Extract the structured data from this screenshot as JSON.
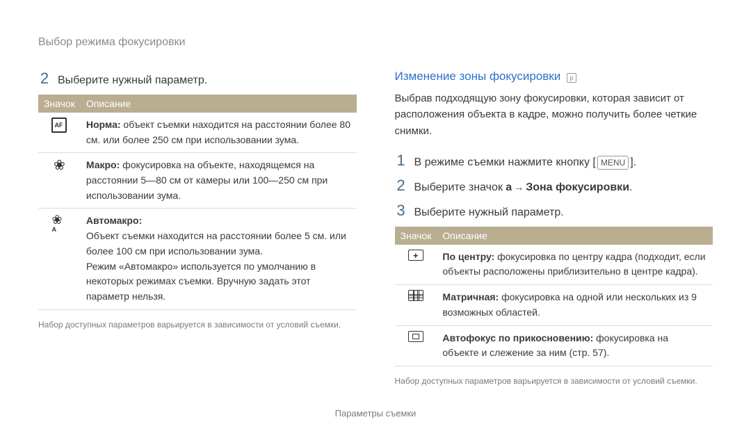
{
  "page_title": "Выбор режима фокусировки",
  "footer": "Параметры съемки",
  "left": {
    "step2_num": "2",
    "step2_text": "Выберите нужный параметр.",
    "table": {
      "head_icon": "Значок",
      "head_desc": "Описание",
      "row1_label": "Норма:",
      "row1_text": " объект съемки находится на расстоянии более 80 см. или более 250 см при использовании зума.",
      "row2_label": "Макро:",
      "row2_text": " фокусировка на объекте, находящемся на расстоянии 5—80 см от камеры или 100—250 см при использовании зума.",
      "row3_label": "Автомакро:",
      "row3_text_a": "Объект съемки находится на расстоянии более 5 см. или более 100 см при использовании зума.",
      "row3_text_b": "Режим «Автомакро» используется по умолчанию в некоторых режимах съемки. Вручную задать этот параметр нельзя."
    },
    "note": "Набор доступных параметров варьируется в зависимости от условий съемки."
  },
  "right": {
    "section_title": "Изменение зоны фокусировки",
    "intro": "Выбрав подходящую зону фокусировки, которая зависит от расположения объекта в кадре, можно получить более четкие снимки.",
    "step1_num": "1",
    "step1_text_a": "В режиме съемки нажмите кнопку [",
    "step1_text_b": "].",
    "step1_kbd": "MENU",
    "step2_num": "2",
    "step2_text_a": "Выберите значок ",
    "step2_bold": "a",
    "step2_arrow": "→",
    "step2_text_b": "Зона фокусировки",
    "step2_text_c": ".",
    "step3_num": "3",
    "step3_text": "Выберите нужный параметр.",
    "table": {
      "head_icon": "Значок",
      "head_desc": "Описание",
      "row1_label": "По центру:",
      "row1_text": " фокусировка по центру кадра (подходит, если объекты расположены приблизительно в центре кадра).",
      "row2_label": "Матричная:",
      "row2_text": " фокусировка на одной или нескольких из 9 возможных областей.",
      "row3_label": "Автофокус по прикосновению:",
      "row3_text": " фокусировка на объекте и слежение за ним (стр. 57)."
    },
    "note": "Набор доступных параметров варьируется в зависимости от условий съемки."
  }
}
